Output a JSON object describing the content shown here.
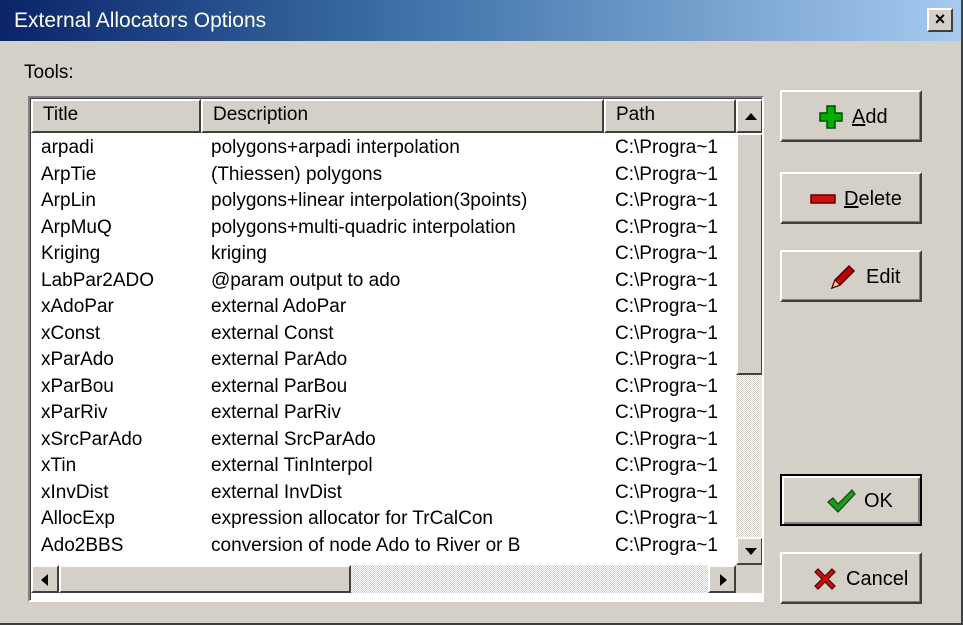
{
  "window": {
    "title": "External Allocators Options",
    "close_glyph": "×"
  },
  "tools_label": "Tools:",
  "table": {
    "columns": [
      "Title",
      "Description",
      "Path"
    ],
    "rows": [
      [
        "arpadi",
        "polygons+arpadi interpolation",
        "C:\\Progra~1"
      ],
      [
        "ArpTie",
        "(Thiessen) polygons",
        "C:\\Progra~1"
      ],
      [
        "ArpLin",
        "polygons+linear interpolation(3points)",
        "C:\\Progra~1"
      ],
      [
        "ArpMuQ",
        "polygons+multi-quadric interpolation",
        "C:\\Progra~1"
      ],
      [
        "Kriging",
        "kriging",
        "C:\\Progra~1"
      ],
      [
        "LabPar2ADO",
        "@param output to ado",
        "C:\\Progra~1"
      ],
      [
        "xAdoPar",
        "external AdoPar",
        "C:\\Progra~1"
      ],
      [
        "xConst",
        "external Const",
        "C:\\Progra~1"
      ],
      [
        "xParAdo",
        "external ParAdo",
        "C:\\Progra~1"
      ],
      [
        "xParBou",
        "external ParBou",
        "C:\\Progra~1"
      ],
      [
        "xParRiv",
        "external ParRiv",
        "C:\\Progra~1"
      ],
      [
        "xSrcParAdo",
        "external SrcParAdo",
        "C:\\Progra~1"
      ],
      [
        "xTin",
        "external TinInterpol",
        "C:\\Progra~1"
      ],
      [
        "xInvDist",
        "external InvDist",
        "C:\\Progra~1"
      ],
      [
        "AllocExp",
        "expression allocator for TrCalCon",
        "C:\\Progra~1"
      ],
      [
        "Ado2BBS",
        "conversion of node Ado to River or B",
        "C:\\Progra~1"
      ]
    ]
  },
  "buttons": {
    "add": {
      "accel": "A",
      "rest": "dd",
      "icon": "plus-icon",
      "color": "#00b000"
    },
    "delete": {
      "accel": "D",
      "rest": "elete",
      "icon": "minus-icon",
      "color": "#d01010"
    },
    "edit": {
      "label": "Edit",
      "icon": "pencil-icon",
      "color": "#c00000"
    },
    "ok": {
      "label": "OK",
      "icon": "checkmark-icon",
      "color": "#1f9a1f"
    },
    "cancel": {
      "label": "Cancel",
      "icon": "x-icon",
      "color": "#cc1010"
    }
  }
}
